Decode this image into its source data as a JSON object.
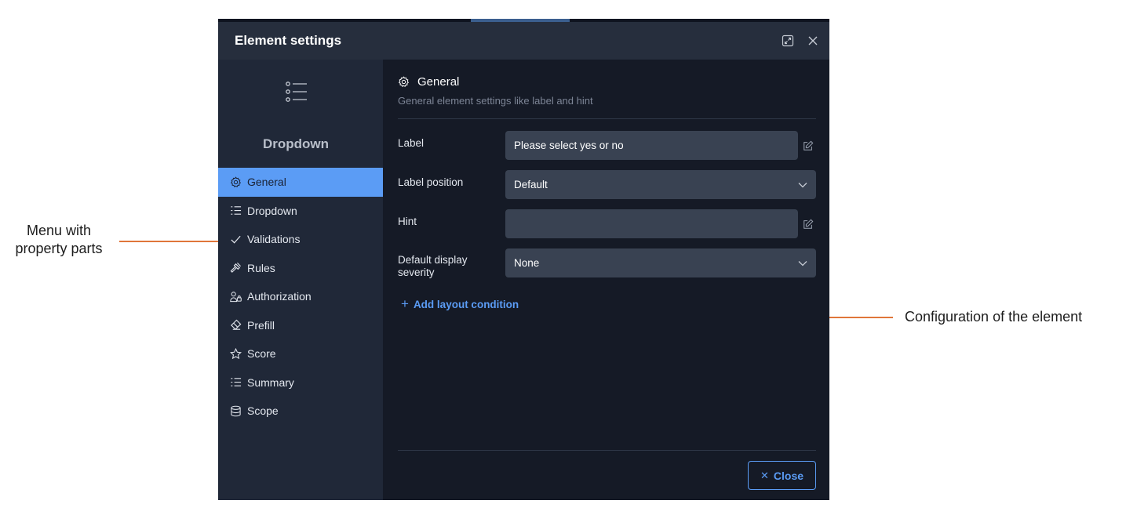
{
  "annotations": {
    "left_line1": "Menu with",
    "left_line2": "property parts",
    "right": "Configuration of the element"
  },
  "dialog": {
    "title": "Element settings",
    "icons": {
      "expand": "expand-icon",
      "close": "close-icon"
    }
  },
  "sidebar": {
    "element_icon": "list-bullets-icon",
    "element_type": "Dropdown",
    "items": [
      {
        "label": "General",
        "icon": "gear-icon",
        "active": true
      },
      {
        "label": "Dropdown",
        "icon": "list-icon",
        "active": false
      },
      {
        "label": "Validations",
        "icon": "check-icon",
        "active": false
      },
      {
        "label": "Rules",
        "icon": "hammer-icon",
        "active": false
      },
      {
        "label": "Authorization",
        "icon": "user-lock-icon",
        "active": false
      },
      {
        "label": "Prefill",
        "icon": "eraser-icon",
        "active": false
      },
      {
        "label": "Score",
        "icon": "star-icon",
        "active": false
      },
      {
        "label": "Summary",
        "icon": "list-icon",
        "active": false
      },
      {
        "label": "Scope",
        "icon": "database-icon",
        "active": false
      }
    ]
  },
  "general": {
    "heading": "General",
    "description": "General element settings like label and hint",
    "fields": {
      "label": {
        "label": "Label",
        "value": "Please select yes or no"
      },
      "label_position": {
        "label": "Label position",
        "value": "Default"
      },
      "hint": {
        "label": "Hint",
        "value": ""
      },
      "default_display_severity": {
        "label_line1": "Default display",
        "label_line2": "severity",
        "value": "None"
      }
    },
    "add_layout_condition": "Add layout condition"
  },
  "footer": {
    "close_label": "Close"
  },
  "colors": {
    "accent": "#5b9cf5",
    "dialog_bg": "#151a26",
    "sidebar_bg": "#202838",
    "header_bg": "#262e3d",
    "input_bg": "#394252",
    "callout_line": "#e0763a"
  }
}
